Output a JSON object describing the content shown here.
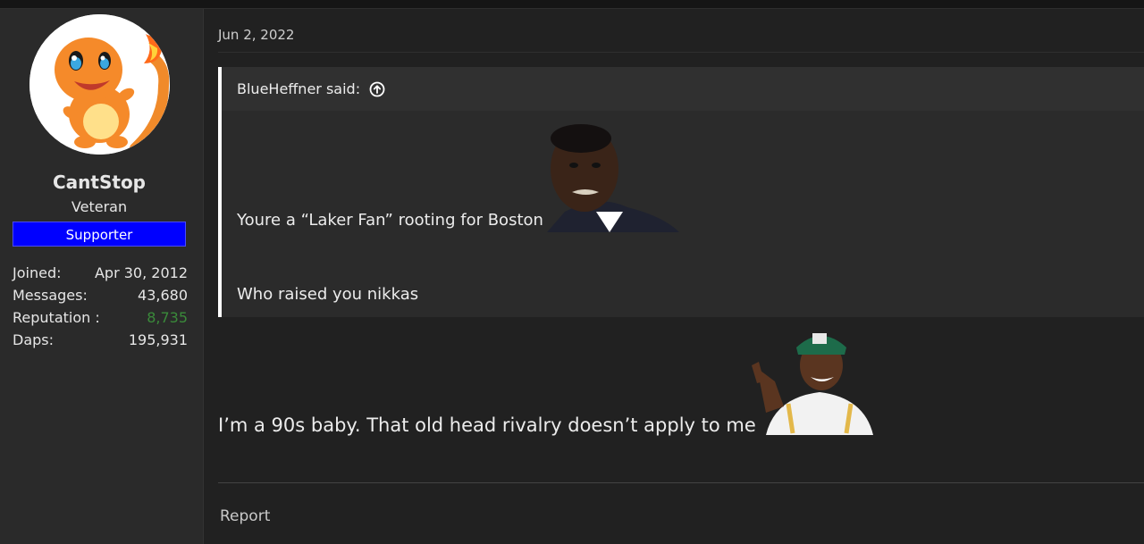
{
  "user": {
    "name": "CantStop",
    "title": "Veteran",
    "banner": "Supporter",
    "stats": [
      {
        "label": "Joined:",
        "value": "Apr 30, 2012"
      },
      {
        "label": "Messages:",
        "value": "43,680"
      },
      {
        "label": "Reputation :",
        "value": "8,735",
        "color": "#3a8a3a"
      },
      {
        "label": "Daps:",
        "value": "195,931"
      }
    ]
  },
  "post": {
    "date": "Jun 2, 2022",
    "quote": {
      "author": "BlueHeffner said:",
      "line1": "Youre a “Laker Fan” rooting for Boston",
      "line2": "Who raised you nikkas"
    },
    "reply": "I’m a 90s baby. That old head rivalry doesn’t apply to me",
    "report_label": "Report"
  },
  "icons": {
    "jump_to_quote": "arrow-up-circle-icon"
  },
  "colors": {
    "banner_bg": "#0000ff",
    "reputation": "#3a8a3a"
  }
}
